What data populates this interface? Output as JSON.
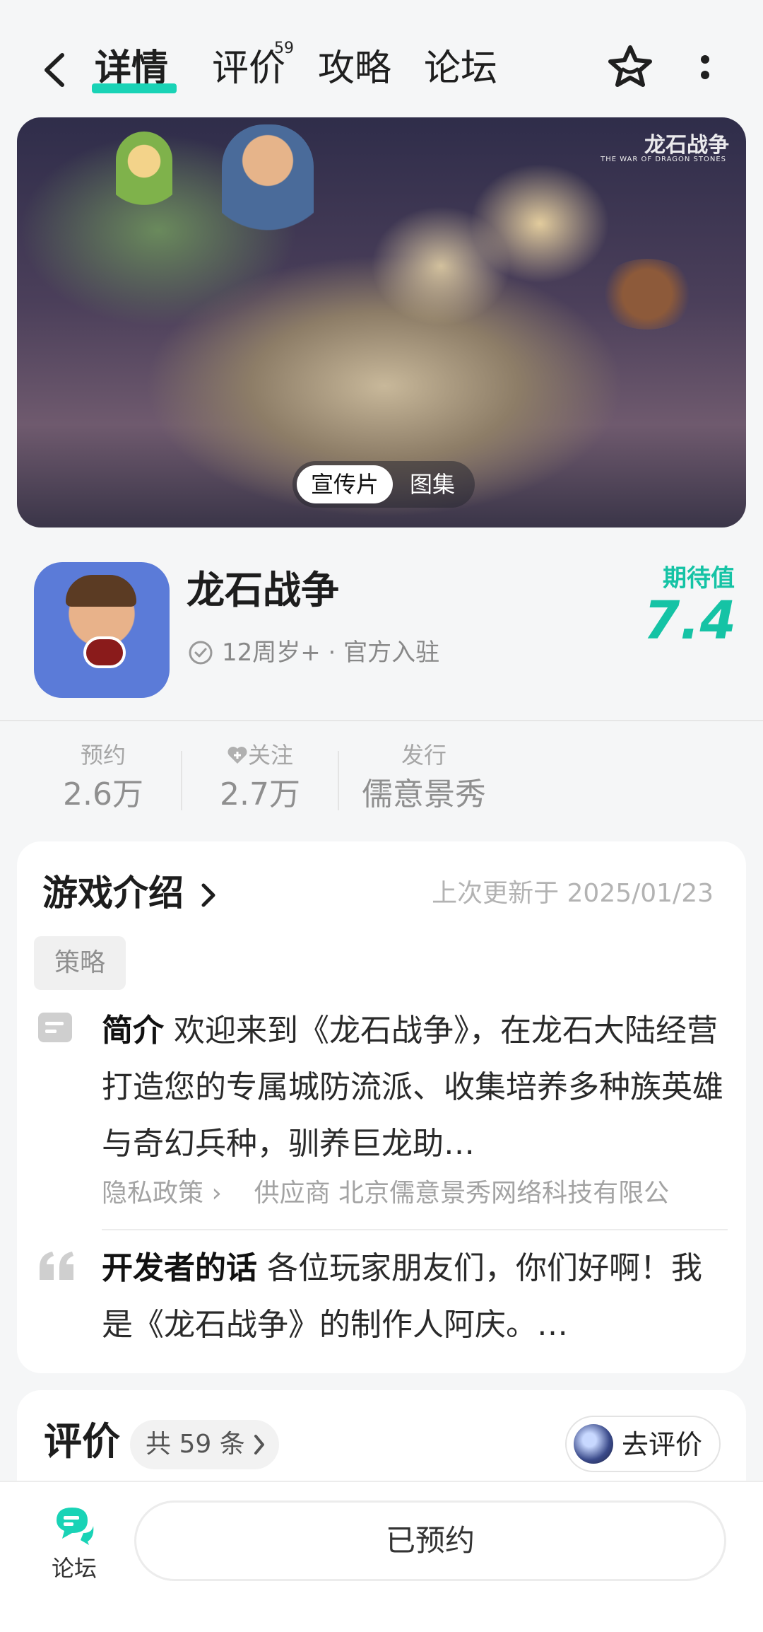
{
  "nav": {
    "tabs": [
      {
        "label": "详情",
        "active": true
      },
      {
        "label": "评价",
        "badge": "59"
      },
      {
        "label": "攻略"
      },
      {
        "label": "论坛"
      }
    ],
    "back_icon": "back-arrow-icon",
    "favorite_icon": "star-icon",
    "more_icon": "more-vertical-icon",
    "accent_color": "#19d3b6"
  },
  "banner": {
    "logo_text": "龙石战争",
    "logo_subtext": "THE WAR OF DRAGON STONES",
    "toggle_video": "宣传片",
    "toggle_gallery": "图集"
  },
  "app": {
    "name": "龙石战争",
    "meta": "12周岁+ · 官方入驻",
    "expect_label": "期待值",
    "expect_value": "7.4"
  },
  "stats": [
    {
      "label": "预约",
      "value": "2.6万"
    },
    {
      "label": "关注",
      "value": "2.7万",
      "icon": "heart-plus-icon"
    },
    {
      "label": "发行",
      "value": "儒意景秀"
    }
  ],
  "intro_card": {
    "title": "游戏介绍",
    "updated": "上次更新于 2025/01/23",
    "tag": "策略",
    "intro_label": "简介",
    "intro_text": "欢迎来到《龙石战争》，在龙石大陆经营打造您的专属城防流派、收集培养多种族英雄与奇幻兵种，驯养巨龙助…",
    "privacy_link": "隐私政策",
    "supplier": "供应商 北京儒意景秀网络科技有限公",
    "dev_label": "开发者的话",
    "dev_text": "各位玩家朋友们，你们好啊！我是《龙石战争》的制作人阿庆。…"
  },
  "reviews": {
    "title": "评价",
    "count": "共 59 条",
    "write_button": "去评价"
  },
  "bottom": {
    "forum_label": "论坛",
    "reserve_button": "已预约"
  }
}
